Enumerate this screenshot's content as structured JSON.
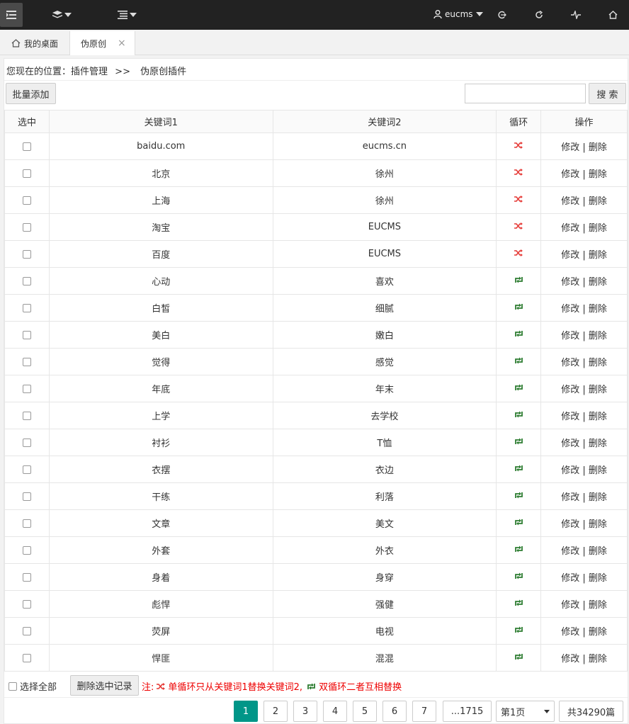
{
  "topbar": {
    "user_name": "eucms",
    "icons": [
      "menu-icon",
      "layers-icon",
      "list-icon",
      "user-icon",
      "logout-icon",
      "refresh-icon",
      "pulse-icon",
      "home-icon"
    ]
  },
  "tabs": {
    "home_label": "我的桌面",
    "active_label": "伪原创",
    "close_glyph": "×"
  },
  "breadcrumb": {
    "prefix": "您现在的位置：",
    "parent": "插件管理",
    "separator": ">>",
    "current": "伪原创插件"
  },
  "toolbar": {
    "batch_add_label": "批量添加",
    "search_value": "",
    "search_label": "搜 索"
  },
  "table": {
    "headers": [
      "选中",
      "关键词1",
      "关键词2",
      "循环",
      "操作"
    ],
    "edit_label": "修改",
    "op_separator": "|",
    "delete_label": "删除",
    "rows": [
      {
        "k1": "baidu.com",
        "k2": "eucms.cn",
        "loop": "single"
      },
      {
        "k1": "北京",
        "k2": "徐州",
        "loop": "single"
      },
      {
        "k1": "上海",
        "k2": "徐州",
        "loop": "single"
      },
      {
        "k1": "淘宝",
        "k2": "EUCMS",
        "loop": "single"
      },
      {
        "k1": "百度",
        "k2": "EUCMS",
        "loop": "single"
      },
      {
        "k1": "心动",
        "k2": "喜欢",
        "loop": "double"
      },
      {
        "k1": "白皙",
        "k2": "细腻",
        "loop": "double"
      },
      {
        "k1": "美白",
        "k2": "嫩白",
        "loop": "double"
      },
      {
        "k1": "觉得",
        "k2": "感觉",
        "loop": "double"
      },
      {
        "k1": "年底",
        "k2": "年末",
        "loop": "double"
      },
      {
        "k1": "上学",
        "k2": "去学校",
        "loop": "double"
      },
      {
        "k1": "衬衫",
        "k2": "T恤",
        "loop": "double"
      },
      {
        "k1": "衣摆",
        "k2": "衣边",
        "loop": "double"
      },
      {
        "k1": "干练",
        "k2": "利落",
        "loop": "double"
      },
      {
        "k1": "文章",
        "k2": "美文",
        "loop": "double"
      },
      {
        "k1": "外套",
        "k2": "外衣",
        "loop": "double"
      },
      {
        "k1": "身着",
        "k2": "身穿",
        "loop": "double"
      },
      {
        "k1": "彪悍",
        "k2": "强健",
        "loop": "double"
      },
      {
        "k1": "荧屏",
        "k2": "电视",
        "loop": "double"
      },
      {
        "k1": "悍匪",
        "k2": "混混",
        "loop": "double"
      }
    ]
  },
  "footer": {
    "select_all_label": "选择全部",
    "delete_selected_label": "删除选中记录",
    "note_prefix": "注:",
    "note_single": "单循环只从关键词1替换关键词2,",
    "note_double": "双循环二者互相替换"
  },
  "pagination": {
    "pages": [
      "1",
      "2",
      "3",
      "4",
      "5",
      "6",
      "7",
      "...1715"
    ],
    "current_page": "1",
    "page_select": "第1页",
    "total_label": "共34290篇"
  },
  "colors": {
    "single_loop": "#e53935",
    "double_loop": "#2e7d32",
    "active_page": "#009688"
  }
}
